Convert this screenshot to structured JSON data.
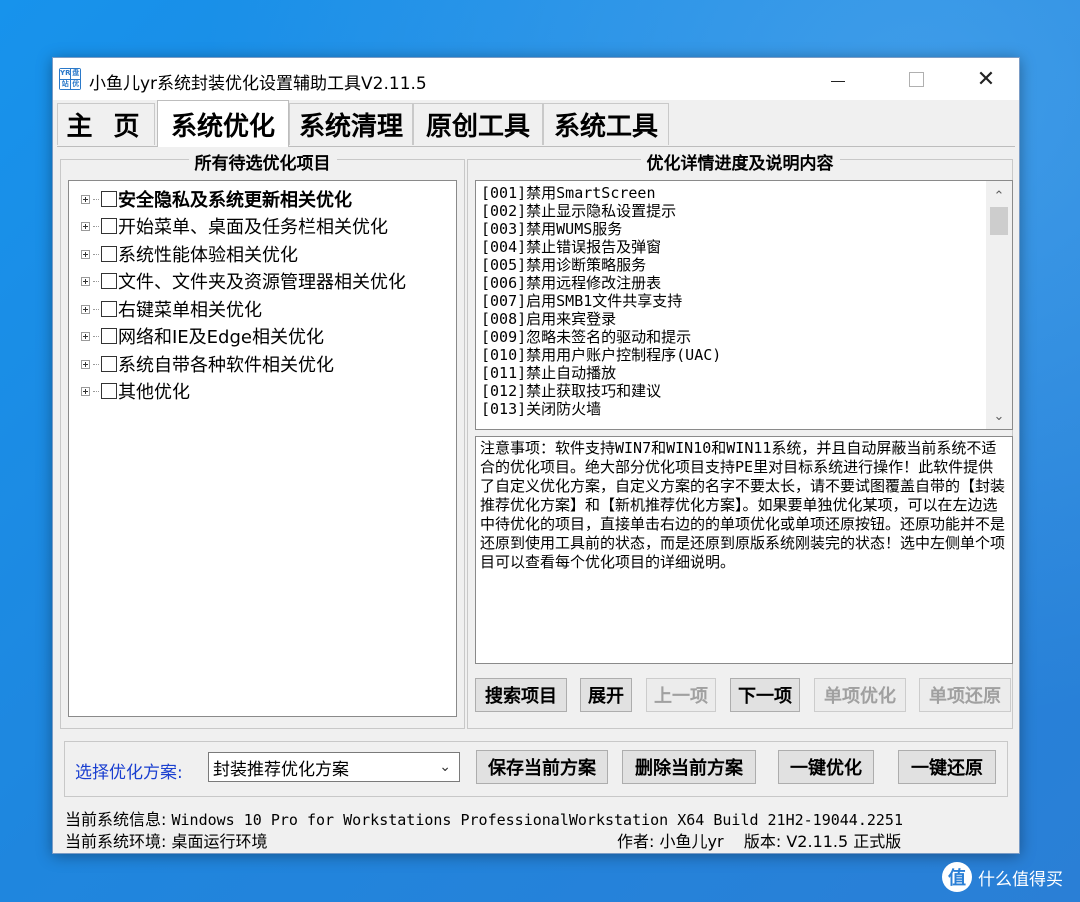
{
  "window": {
    "title": "小鱼儿yr系统封装优化设置辅助工具V2.11.5",
    "icon_text": [
      "YR",
      "盘",
      "站",
      "优"
    ]
  },
  "tabs": [
    {
      "label": "主 页",
      "active": false
    },
    {
      "label": "系统优化",
      "active": true
    },
    {
      "label": "系统清理",
      "active": false
    },
    {
      "label": "原创工具",
      "active": false
    },
    {
      "label": "系统工具",
      "active": false
    }
  ],
  "left_panel": {
    "title": "所有待选优化项目",
    "items": [
      {
        "label": "安全隐私及系统更新相关优化",
        "bold": true
      },
      {
        "label": "开始菜单、桌面及任务栏相关优化",
        "bold": false
      },
      {
        "label": "系统性能体验相关优化",
        "bold": false
      },
      {
        "label": "文件、文件夹及资源管理器相关优化",
        "bold": false
      },
      {
        "label": "右键菜单相关优化",
        "bold": false
      },
      {
        "label": "网络和IE及Edge相关优化",
        "bold": false
      },
      {
        "label": "系统自带各种软件相关优化",
        "bold": false
      },
      {
        "label": "其他优化",
        "bold": false
      }
    ]
  },
  "right_panel": {
    "title": "优化详情进度及说明内容",
    "list_items": [
      "[001]禁用SmartScreen",
      "[002]禁止显示隐私设置提示",
      "[003]禁用WUMS服务",
      "[004]禁止错误报告及弹窗",
      "[005]禁用诊断策略服务",
      "[006]禁用远程修改注册表",
      "[007]启用SMB1文件共享支持",
      "[008]启用来宾登录",
      "[009]忽略未签名的驱动和提示",
      "[010]禁用用户账户控制程序(UAC)",
      "[011]禁止自动播放",
      "[012]禁止获取技巧和建议",
      "[013]关闭防火墙"
    ],
    "notes": "注意事项：软件支持WIN7和WIN10和WIN11系统，并且自动屏蔽当前系统不适合的优化项目。绝大部分优化项目支持PE里对目标系统进行操作！此软件提供了自定义优化方案，自定义方案的名字不要太长，请不要试图覆盖自带的【封装推荐优化方案】和【新机推荐优化方案】。如果要单独优化某项，可以在左边选中待优化的项目，直接单击右边的的单项优化或单项还原按钮。还原功能并不是还原到使用工具前的状态，而是还原到原版系统刚装完的状态！选中左侧单个项目可以查看每个优化项目的详细说明。",
    "buttons": {
      "search": "搜索项目",
      "expand": "展开",
      "prev": "上一项",
      "next": "下一项",
      "single_optimize": "单项优化",
      "single_restore": "单项还原"
    }
  },
  "scheme": {
    "label": "选择优化方案:",
    "selected": "封装推荐优化方案",
    "save": "保存当前方案",
    "delete": "删除当前方案",
    "one_click_optimize": "一键优化",
    "one_click_restore": "一键还原"
  },
  "status": {
    "system_info_label": "当前系统信息:",
    "system_info_value": "Windows 10 Pro for Workstations ProfessionalWorkstation X64 Build 21H2-19044.2251",
    "env_label": "当前系统环境:",
    "env_value": "桌面运行环境",
    "author": "作者: 小鱼儿yr",
    "version": "版本: V2.11.5 正式版"
  },
  "watermark": {
    "icon": "值",
    "text": "什么值得买"
  },
  "colors": {
    "desktop": "#1f86de",
    "scheme_label": "#1a3fd0",
    "disabled_text": "#a0a0a0"
  }
}
